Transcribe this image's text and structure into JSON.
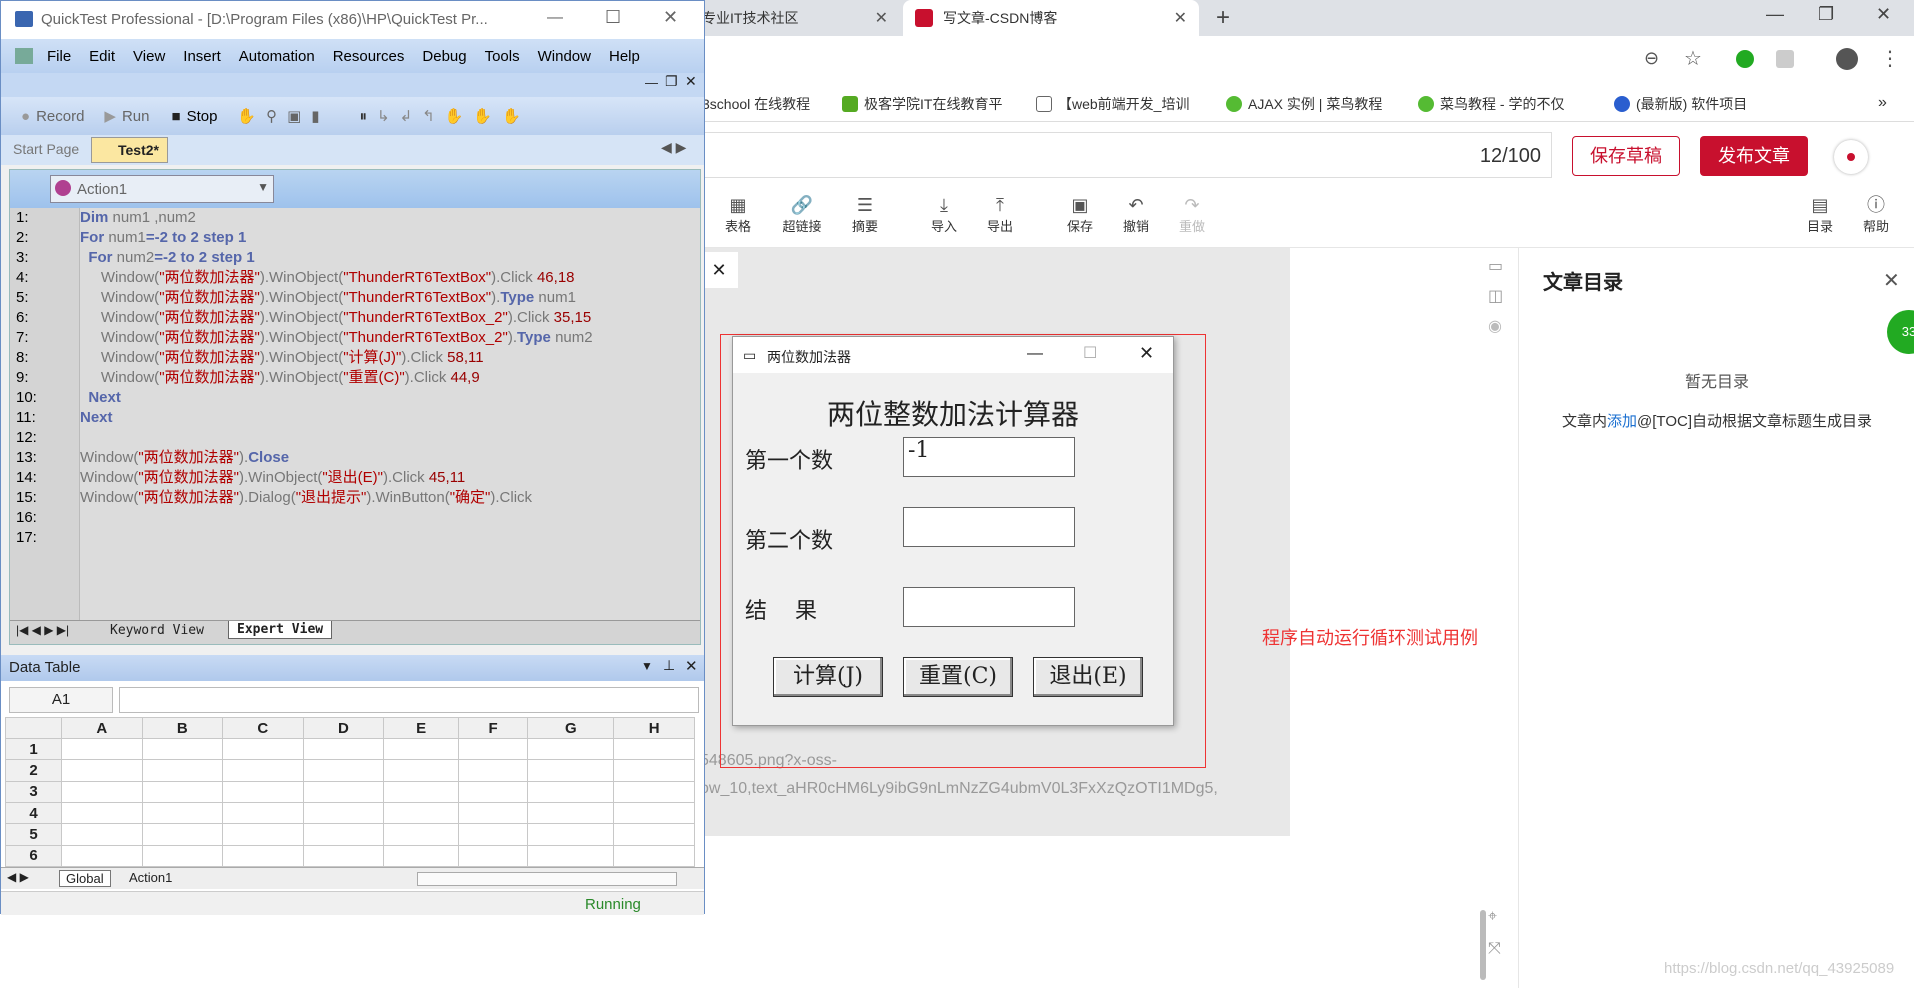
{
  "browser": {
    "tabs": [
      {
        "label": "专业IT技术社区"
      },
      {
        "label": "写文章-CSDN博客"
      }
    ],
    "new_tab": "+",
    "bookmarks": [
      "3school 在线教程",
      "极客学院IT在线教育平",
      "【web前端开发_培训",
      "AJAX 实例 | 菜鸟教程",
      "菜鸟教程 - 学的不仅",
      "(最新版) 软件项目"
    ],
    "more": "»"
  },
  "csdn": {
    "word_count": "12/100",
    "save_draft": "保存草稿",
    "publish": "发布文章",
    "toolbar": [
      {
        "icon": "table-icon",
        "label": "表格"
      },
      {
        "icon": "link-icon",
        "label": "超链接"
      },
      {
        "icon": "summary-icon",
        "label": "摘要"
      },
      {
        "icon": "import-icon",
        "label": "导入"
      },
      {
        "icon": "export-icon",
        "label": "导出"
      },
      {
        "icon": "save-icon",
        "label": "保存"
      },
      {
        "icon": "undo-icon",
        "label": "撤销"
      },
      {
        "icon": "redo-icon",
        "label": "重做"
      },
      {
        "icon": "toc-icon",
        "label": "目录"
      },
      {
        "icon": "help-icon",
        "label": "帮助"
      }
    ],
    "toc_title": "文章目录",
    "toc_empty": "暂无目录",
    "toc_hint_pre": "文章内",
    "toc_hint_link": "添加",
    "toc_hint_post": "@[TOC]自动根据文章标题生成目录",
    "snippet1": "548605.png?x-oss-",
    "snippet2": "ow_10,text_aHR0cHM6Ly9ibG9nLmNzZG4ubmV0L3FxXzQzOTI1MDg5,",
    "annotation": "程序自动运行循环测试用例",
    "badge": "33",
    "watermark": "https://blog.csdn.net/qq_43925089"
  },
  "qtp": {
    "title": "QuickTest Professional - [D:\\Program Files (x86)\\HP\\QuickTest Pr...",
    "menu": [
      "File",
      "Edit",
      "View",
      "Insert",
      "Automation",
      "Resources",
      "Debug",
      "Tools",
      "Window",
      "Help"
    ],
    "toolbar": {
      "record": "Record",
      "run": "Run",
      "stop": "Stop"
    },
    "doc_tabs": [
      "Start Page",
      "Test2*"
    ],
    "action": "Action1",
    "line_numbers": [
      "1:",
      "2:",
      "3:",
      "4:",
      "5:",
      "6:",
      "7:",
      "8:",
      "9:",
      "10:",
      "11:",
      "12:",
      "13:",
      "14:",
      "15:",
      "16:",
      "17:"
    ],
    "code": [
      [
        [
          "k",
          "Dim"
        ],
        [
          "t",
          " num1 ,num2"
        ]
      ],
      [
        [
          "k",
          "For"
        ],
        [
          "t",
          " num1"
        ],
        [
          "k",
          "=-2 to 2 step 1"
        ]
      ],
      [
        [
          "t",
          "  "
        ],
        [
          "k",
          "For"
        ],
        [
          "t",
          " num2"
        ],
        [
          "k",
          "=-2 to 2 step 1"
        ]
      ],
      [
        [
          "t",
          "     Window("
        ],
        [
          "s",
          "\"两位数加法器\""
        ],
        [
          "t",
          ").WinObject("
        ],
        [
          "s",
          "\"ThunderRT6TextBox\""
        ],
        [
          "t",
          ").Click "
        ],
        [
          "n",
          "46,18"
        ]
      ],
      [
        [
          "t",
          "     Window("
        ],
        [
          "s",
          "\"两位数加法器\""
        ],
        [
          "t",
          ").WinObject("
        ],
        [
          "s",
          "\"ThunderRT6TextBox\""
        ],
        [
          "t",
          ")."
        ],
        [
          "k",
          "Type"
        ],
        [
          "t",
          " num1"
        ]
      ],
      [
        [
          "t",
          "     Window("
        ],
        [
          "s",
          "\"两位数加法器\""
        ],
        [
          "t",
          ").WinObject("
        ],
        [
          "s",
          "\"ThunderRT6TextBox_2\""
        ],
        [
          "t",
          ").Click "
        ],
        [
          "n",
          "35,15"
        ]
      ],
      [
        [
          "t",
          "     Window("
        ],
        [
          "s",
          "\"两位数加法器\""
        ],
        [
          "t",
          ").WinObject("
        ],
        [
          "s",
          "\"ThunderRT6TextBox_2\""
        ],
        [
          "t",
          ")."
        ],
        [
          "k",
          "Type"
        ],
        [
          "t",
          " num2"
        ]
      ],
      [
        [
          "t",
          "     Window("
        ],
        [
          "s",
          "\"两位数加法器\""
        ],
        [
          "t",
          ").WinObject("
        ],
        [
          "s",
          "\"计算(J)\""
        ],
        [
          "t",
          ").Click "
        ],
        [
          "n",
          "58,11"
        ]
      ],
      [
        [
          "t",
          "     Window("
        ],
        [
          "s",
          "\"两位数加法器\""
        ],
        [
          "t",
          ").WinObject("
        ],
        [
          "s",
          "\"重置(C)\""
        ],
        [
          "t",
          ").Click "
        ],
        [
          "n",
          "44,9"
        ]
      ],
      [
        [
          "t",
          "  "
        ],
        [
          "k",
          "Next"
        ]
      ],
      [
        [
          "k",
          "Next"
        ]
      ],
      [],
      [
        [
          "t",
          "Window("
        ],
        [
          "s",
          "\"两位数加法器\""
        ],
        [
          "t",
          ")."
        ],
        [
          "k",
          "Close"
        ]
      ],
      [
        [
          "t",
          "Window("
        ],
        [
          "s",
          "\"两位数加法器\""
        ],
        [
          "t",
          ").WinObject("
        ],
        [
          "s",
          "\"退出(E)\""
        ],
        [
          "t",
          ").Click "
        ],
        [
          "n",
          "45,11"
        ]
      ],
      [
        [
          "t",
          "Window("
        ],
        [
          "s",
          "\"两位数加法器\""
        ],
        [
          "t",
          ").Dialog("
        ],
        [
          "s",
          "\"退出提示\""
        ],
        [
          "t",
          ").WinButton("
        ],
        [
          "s",
          "\"确定\""
        ],
        [
          "t",
          ").Click"
        ]
      ],
      [],
      []
    ],
    "view_tabs": [
      "Keyword View",
      "Expert View"
    ],
    "data_table": {
      "title": "Data Table",
      "cell_ref": "A1",
      "columns": [
        "A",
        "B",
        "C",
        "D",
        "E",
        "F",
        "G",
        "H"
      ],
      "rows": [
        "1",
        "2",
        "3",
        "4",
        "5",
        "6"
      ],
      "sheets": [
        "Global",
        "Action1"
      ]
    },
    "status": "Running"
  },
  "calc": {
    "title": "两位数加法器",
    "heading": "两位整数加法计算器",
    "label1": "第一个数",
    "value1": "-1",
    "label2": "第二个数",
    "value2": "",
    "label3": "结    果",
    "value3": "",
    "btn_calc": "计算(J)",
    "btn_reset": "重置(C)",
    "btn_exit": "退出(E)"
  }
}
